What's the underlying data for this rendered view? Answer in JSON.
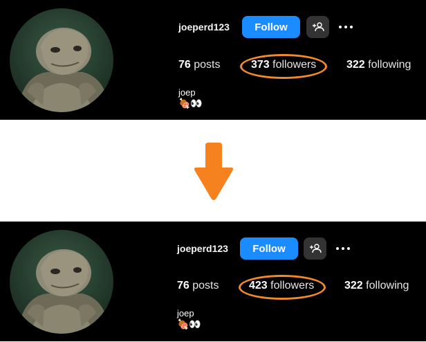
{
  "before": {
    "username": "joeperd123",
    "follow_label": "Follow",
    "posts": {
      "count": "76",
      "label": "posts"
    },
    "followers": {
      "count": "373",
      "label": "followers"
    },
    "following": {
      "count": "322",
      "label": "following"
    },
    "bio": {
      "name": "joep",
      "emoji": "🍖👀"
    }
  },
  "after": {
    "username": "joeperd123",
    "follow_label": "Follow",
    "posts": {
      "count": "76",
      "label": "posts"
    },
    "followers": {
      "count": "423",
      "label": "followers"
    },
    "following": {
      "count": "322",
      "label": "following"
    },
    "bio": {
      "name": "joep",
      "emoji": "🍖👀"
    }
  },
  "colors": {
    "panel_background": "#000000",
    "follow_button": "#1a8cff",
    "secondary_button": "#333333",
    "highlight": "#f08a2a",
    "arrow": "#f5821f"
  },
  "icons": {
    "suggest": "add-person-icon",
    "more": "more-dots-icon",
    "transition": "down-arrow-icon"
  }
}
